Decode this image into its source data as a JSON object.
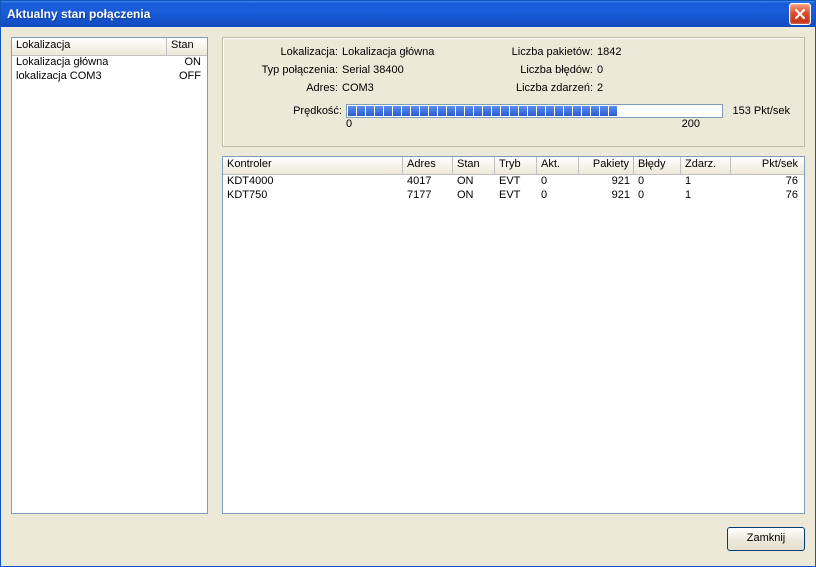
{
  "window": {
    "title": "Aktualny stan połączenia",
    "close_button_label": "Close"
  },
  "left_list": {
    "headers": {
      "location": "Lokalizacja",
      "state": "Stan"
    },
    "rows": [
      {
        "location": "Lokalizacja główna",
        "state": "ON"
      },
      {
        "location": "lokalizacja COM3",
        "state": "OFF"
      }
    ]
  },
  "stats": {
    "labels": {
      "location": "Lokalizacja:",
      "conn_type": "Typ połączenia:",
      "address": "Adres:",
      "packets": "Liczba pakietów:",
      "errors": "Liczba błędów:",
      "events": "Liczba zdarzeń:",
      "speed": "Prędkość:"
    },
    "values": {
      "location": "Lokalizacja główna",
      "conn_type": "Serial 38400",
      "address": "COM3",
      "packets": "1842",
      "errors": "0",
      "events": "2",
      "speed_text": "153 Pkt/sek",
      "scale_min": "0",
      "scale_max": "200"
    }
  },
  "controllers": {
    "headers": {
      "controller": "Kontroler",
      "address": "Adres",
      "state": "Stan",
      "mode": "Tryb",
      "act": "Akt.",
      "packets": "Pakiety",
      "errors": "Błędy",
      "events": "Zdarz.",
      "pps": "Pkt/sek"
    },
    "rows": [
      {
        "controller": "KDT4000",
        "address": "4017",
        "state": "ON",
        "mode": "EVT",
        "act": "0",
        "packets": "921",
        "errors": "0",
        "events": "1",
        "pps": "76"
      },
      {
        "controller": "KDT750",
        "address": "7177",
        "state": "ON",
        "mode": "EVT",
        "act": "0",
        "packets": "921",
        "errors": "0",
        "events": "1",
        "pps": "76"
      }
    ]
  },
  "footer": {
    "close_label": "Zamknij"
  }
}
